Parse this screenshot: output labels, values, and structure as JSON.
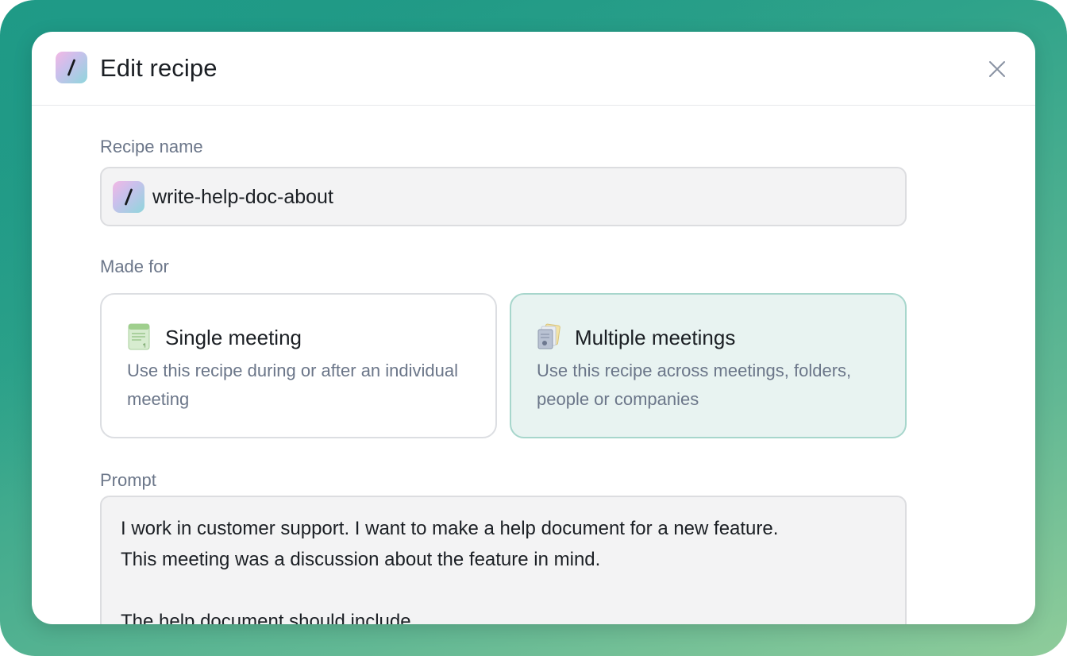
{
  "dialog": {
    "title": "Edit recipe",
    "app_icon": "slash-icon",
    "close_icon": "close-icon"
  },
  "recipe_name": {
    "label": "Recipe name",
    "value": "write-help-doc-about",
    "icon": "slash-icon"
  },
  "made_for": {
    "label": "Made for",
    "selected": "Multiple meetings",
    "options": [
      {
        "title": "Single meeting",
        "description": "Use this recipe during or after an individual meeting",
        "icon": "single-document-icon"
      },
      {
        "title": "Multiple meetings",
        "description": "Use this recipe across meetings, folders, people or companies",
        "icon": "stacked-documents-icon"
      }
    ]
  },
  "prompt": {
    "label": "Prompt",
    "value": "I work in customer support. I want to make a help document for a new feature.\nThis meeting was a discussion about the feature in mind.\n\nThe help document should include"
  },
  "colors": {
    "accent": "#1f9a87",
    "selected_card_bg": "#e8f3f1",
    "selected_card_border": "#a7d6cc",
    "label_text": "#6b7689"
  }
}
